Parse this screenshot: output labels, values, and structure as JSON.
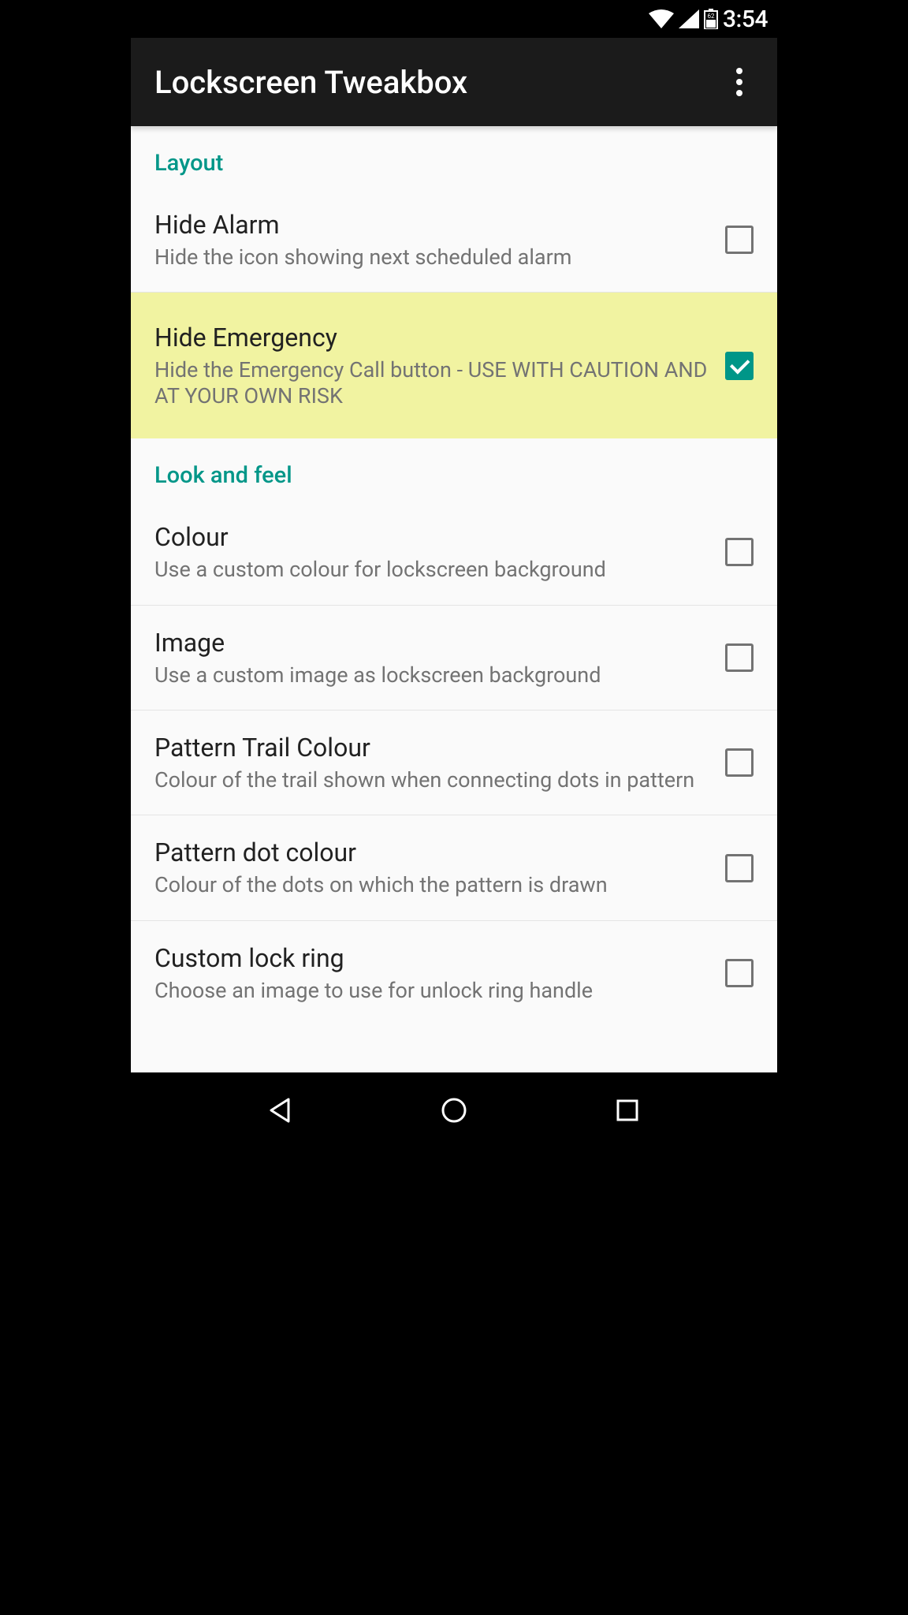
{
  "statusbar": {
    "time": "3:54",
    "battery_level": "62"
  },
  "appbar": {
    "title": "Lockscreen Tweakbox"
  },
  "sections": {
    "layout": {
      "title": "Layout",
      "items": [
        {
          "title": "Hide Alarm",
          "desc": "Hide the icon showing next scheduled alarm",
          "checked": false,
          "highlight": false
        },
        {
          "title": "Hide Emergency",
          "desc": "Hide the Emergency Call button - USE WITH CAUTION AND AT YOUR OWN RISK",
          "checked": true,
          "highlight": true
        }
      ]
    },
    "lookandfeel": {
      "title": "Look and feel",
      "items": [
        {
          "title": "Colour",
          "desc": "Use a custom colour for lockscreen background",
          "checked": false
        },
        {
          "title": "Image",
          "desc": "Use a custom image as lockscreen background",
          "checked": false
        },
        {
          "title": "Pattern Trail Colour",
          "desc": "Colour of the trail shown when connecting dots in pattern",
          "checked": false
        },
        {
          "title": "Pattern dot colour",
          "desc": "Colour of the dots on which the pattern is drawn",
          "checked": false
        },
        {
          "title": "Custom lock ring",
          "desc": "Choose an image to use for unlock ring handle",
          "checked": false
        }
      ]
    }
  }
}
